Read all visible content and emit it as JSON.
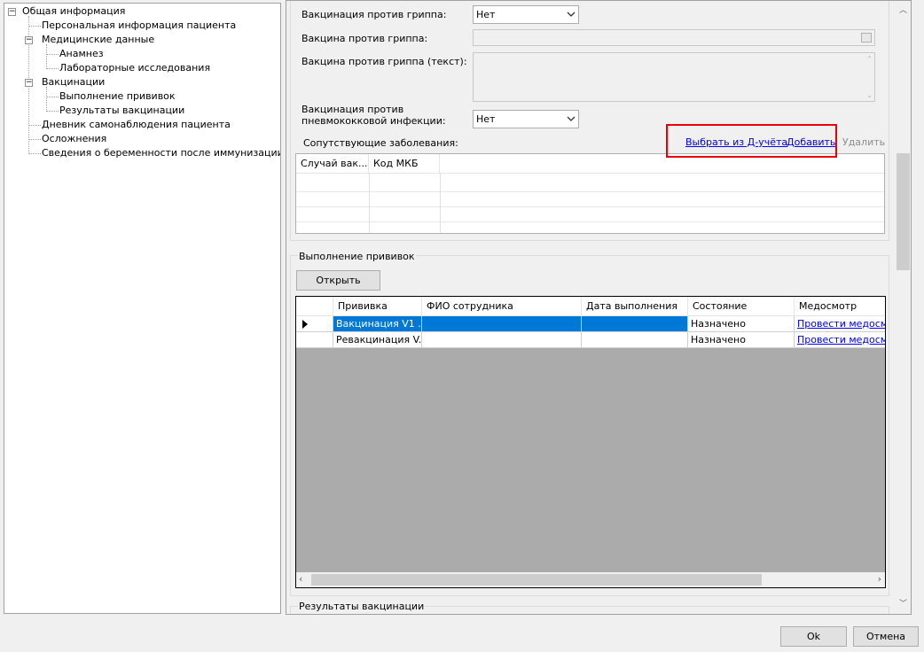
{
  "tree": {
    "items": [
      {
        "label": "Общая информация",
        "level": 0,
        "expander": "⊟"
      },
      {
        "label": "Персональная информация пациента",
        "level": 1
      },
      {
        "label": "Медицинские данные",
        "level": 1,
        "expander": "⊟"
      },
      {
        "label": "Анамнез",
        "level": 2
      },
      {
        "label": "Лабораторные исследования",
        "level": 2
      },
      {
        "label": "Вакцинации",
        "level": 1,
        "expander": "⊟"
      },
      {
        "label": "Выполнение прививок",
        "level": 2
      },
      {
        "label": "Результаты вакцинации",
        "level": 2
      },
      {
        "label": "Дневник самонаблюдения пациента",
        "level": 1
      },
      {
        "label": "Осложнения",
        "level": 1
      },
      {
        "label": "Сведения о беременности после иммунизации",
        "level": 1
      }
    ]
  },
  "form": {
    "flu_vaccination_label": "Вакцинация против гриппа:",
    "flu_vaccination_value": "Нет",
    "flu_vaccine_label": "Вакцина против гриппа:",
    "flu_vaccine_text_label": "Вакцина против гриппа (текст):",
    "pneumo_label_line1": "Вакцинация против",
    "pneumo_label_line2": "пневмококковой инфекции:",
    "pneumo_value": "Нет",
    "comorbid_label": "Сопутствующие заболевания:",
    "select_from_d_link": "Выбрать из Д-учёта",
    "add_link": "Добавить",
    "delete_link": "Удалить",
    "comorbid_columns": [
      "Случай вак...",
      "Код МКБ"
    ]
  },
  "vaccinations": {
    "group_title": "Выполнение прививок",
    "open_button": "Открыть",
    "columns": [
      "Прививка",
      "ФИО сотрудника",
      "Дата выполнения",
      "Состояние",
      "Медосмотр"
    ],
    "rows": [
      {
        "name": "Вакцинация V1 ...",
        "employee": "",
        "date": "",
        "state": "Назначено",
        "exam": "Провести медосмо",
        "selected": true
      },
      {
        "name": "Ревакцинация V...",
        "employee": "",
        "date": "",
        "state": "Назначено",
        "exam": "Провести медосмо",
        "selected": false
      }
    ]
  },
  "results": {
    "group_title": "Результаты вакцинации"
  },
  "footer": {
    "ok": "Ok",
    "cancel": "Отмена"
  },
  "colors": {
    "selection": "#0078d7",
    "highlight_box": "#e8000e",
    "link": "#0000ee"
  }
}
